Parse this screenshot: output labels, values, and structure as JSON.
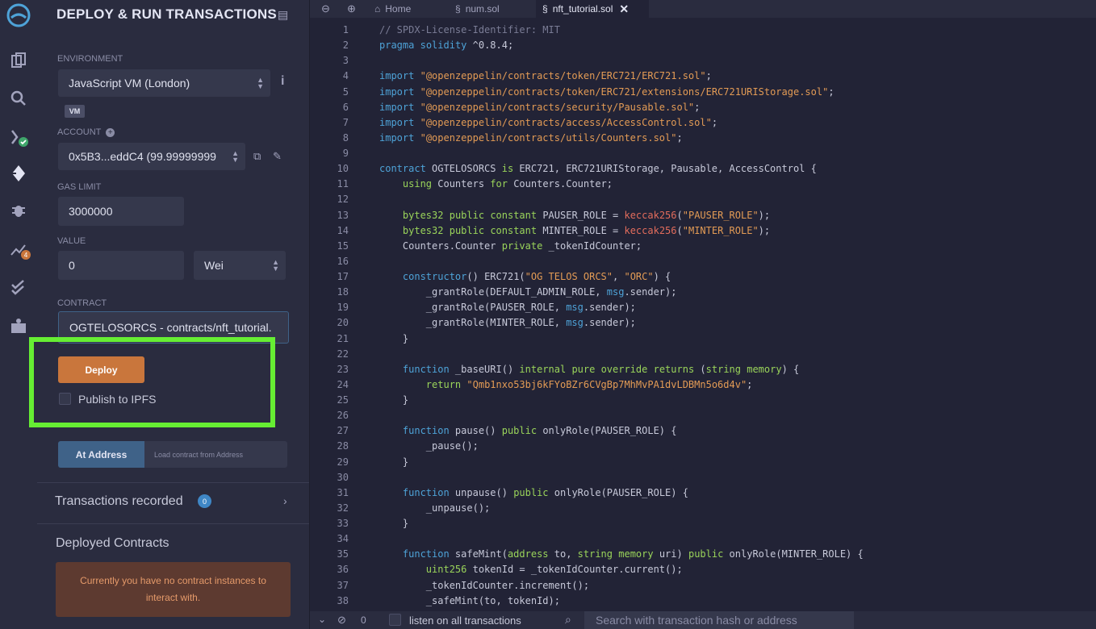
{
  "icon_bar": [
    {
      "name": "remix-logo-icon"
    },
    {
      "name": "file-explorer-icon"
    },
    {
      "name": "search-icon"
    },
    {
      "name": "solidity-compiler-icon"
    },
    {
      "name": "deploy-run-icon"
    },
    {
      "name": "debugger-icon"
    },
    {
      "name": "analytics-icon"
    },
    {
      "name": "testing-icon"
    },
    {
      "name": "learneth-icon"
    }
  ],
  "panel": {
    "title": "DEPLOY & RUN TRANSACTIONS",
    "environment_label": "ENVIRONMENT",
    "environment_value": "JavaScript VM (London)",
    "vm_tag": "VM",
    "account_label": "ACCOUNT",
    "account_value": "0x5B3...eddC4 (99.99999999",
    "gas_limit_label": "GAS LIMIT",
    "gas_limit_value": "3000000",
    "value_label": "VALUE",
    "value_value": "0",
    "value_unit": "Wei",
    "contract_label": "CONTRACT",
    "contract_value": "OGTELOSORCS - contracts/nft_tutorial.",
    "deploy_label": "Deploy",
    "publish_label": "Publish to IPFS",
    "at_address_label": "At Address",
    "at_address_placeholder": "Load contract from Address",
    "transactions_label": "Transactions recorded",
    "transactions_count": "0",
    "deployed_label": "Deployed Contracts",
    "no_instances": "Currently you have no contract instances to interact with."
  },
  "tabs": [
    {
      "label": "Home"
    },
    {
      "label": "num.sol"
    },
    {
      "label": "nft_tutorial.sol"
    }
  ],
  "code": [
    "// SPDX-License-Identifier: MIT",
    "pragma solidity ^0.8.4;",
    "",
    "import \"@openzeppelin/contracts/token/ERC721/ERC721.sol\";",
    "import \"@openzeppelin/contracts/token/ERC721/extensions/ERC721URIStorage.sol\";",
    "import \"@openzeppelin/contracts/security/Pausable.sol\";",
    "import \"@openzeppelin/contracts/access/AccessControl.sol\";",
    "import \"@openzeppelin/contracts/utils/Counters.sol\";",
    "",
    "contract OGTELOSORCS is ERC721, ERC721URIStorage, Pausable, AccessControl {",
    "    using Counters for Counters.Counter;",
    "",
    "    bytes32 public constant PAUSER_ROLE = keccak256(\"PAUSER_ROLE\");",
    "    bytes32 public constant MINTER_ROLE = keccak256(\"MINTER_ROLE\");",
    "    Counters.Counter private _tokenIdCounter;",
    "",
    "    constructor() ERC721(\"OG TELOS ORCS\", \"ORC\") {",
    "        _grantRole(DEFAULT_ADMIN_ROLE, msg.sender);",
    "        _grantRole(PAUSER_ROLE, msg.sender);",
    "        _grantRole(MINTER_ROLE, msg.sender);",
    "    }",
    "",
    "    function _baseURI() internal pure override returns (string memory) {",
    "        return \"Qmb1nxo53bj6kFYoBZr6CVgBp7MhMvPA1dvLDBMn5o6d4v\";",
    "    }",
    "",
    "    function pause() public onlyRole(PAUSER_ROLE) {",
    "        _pause();",
    "    }",
    "",
    "    function unpause() public onlyRole(PAUSER_ROLE) {",
    "        _unpause();",
    "    }",
    "",
    "    function safeMint(address to, string memory uri) public onlyRole(MINTER_ROLE) {",
    "        uint256 tokenId = _tokenIdCounter.current();",
    "        _tokenIdCounter.increment();",
    "        _safeMint(to, tokenId);"
  ],
  "status_bar": {
    "count": "0",
    "listen_label": "listen on all transactions",
    "search_placeholder": "Search with transaction hash or address"
  }
}
